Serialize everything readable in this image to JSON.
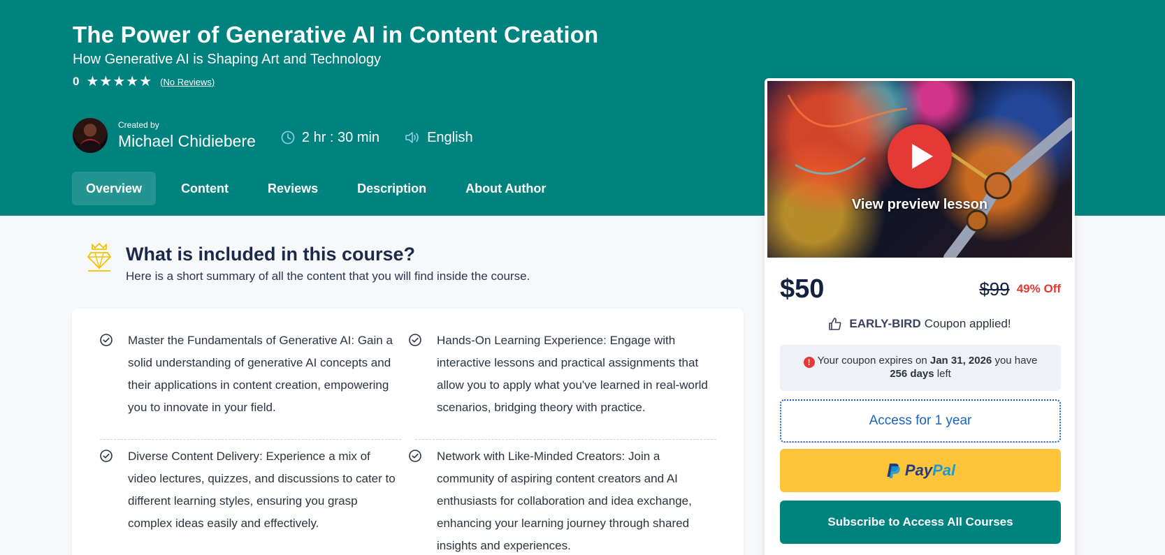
{
  "course": {
    "title": "The Power of Generative AI in Content Creation",
    "subtitle": "How Generative AI is Shaping Art and Technology",
    "rating": "0",
    "stars": [
      "★",
      "★",
      "★",
      "★",
      "★"
    ],
    "reviews_link": "(No Reviews)",
    "created_by_label": "Created by",
    "author": "Michael Chidiebere",
    "duration": "2 hr : 30 min",
    "language": "English"
  },
  "tabs": [
    {
      "label": "Overview",
      "active": true
    },
    {
      "label": "Content"
    },
    {
      "label": "Reviews"
    },
    {
      "label": "Description"
    },
    {
      "label": "About Author"
    }
  ],
  "included": {
    "title": "What is included in this course?",
    "description": "Here is a short summary of all the content that you will find inside the course.",
    "items": [
      "Master the Fundamentals of Generative AI: Gain a solid understanding of generative AI concepts and their applications in content creation, empowering you to innovate in your field.",
      "Hands-On Learning Experience: Engage with interactive lessons and practical assignments that allow you to apply what you've learned in real-world scenarios, bridging theory with practice.",
      "Diverse Content Delivery: Experience a mix of video lectures, quizzes, and discussions to cater to different learning styles, ensuring you grasp complex ideas easily and effectively.",
      "Network with Like-Minded Creators: Join a community of aspiring content creators and AI enthusiasts for collaboration and idea exchange, enhancing your learning journey through shared insights and experiences."
    ]
  },
  "card": {
    "preview_label": "View preview lesson",
    "price": "$50",
    "old_price": "$99",
    "discount": "49% Off",
    "coupon_code": "EARLY-BIRD",
    "coupon_text": "Coupon applied!",
    "expiry_prefix": "Your coupon expires on",
    "expiry_date": "Jan 31, 2026",
    "expiry_mid": "you have",
    "days_left": "256 days",
    "expiry_suffix": "left",
    "access_label": "Access for 1 year",
    "paypal_pay": "Pay",
    "paypal_pal": "Pal",
    "subscribe_label": "Subscribe to Access All Courses"
  },
  "colors": {
    "brand": "#00837f",
    "accent_red": "#e53935",
    "paypal_yellow": "#ffc439",
    "link_blue": "#1a63c5"
  }
}
